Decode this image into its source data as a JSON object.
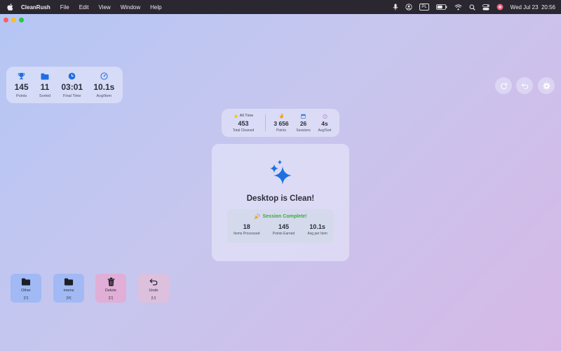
{
  "menubar": {
    "app_name": "CleanRush",
    "menus": [
      "File",
      "Edit",
      "View",
      "Window",
      "Help"
    ],
    "input_source": "PL",
    "datetime": "Wed Jul 23  20:56"
  },
  "session_stats": [
    {
      "icon": "trophy-icon",
      "value": "145",
      "label": "Points"
    },
    {
      "icon": "folder-icon",
      "value": "11",
      "label": "Sorted"
    },
    {
      "icon": "clock-icon",
      "value": "03:01",
      "label": "Final Time"
    },
    {
      "icon": "speedometer-icon",
      "value": "10.1s",
      "label": "Avg/Item"
    }
  ],
  "all_time": {
    "heading": "All Time",
    "total_value": "453",
    "total_label": "Total Cleaned",
    "stats": [
      {
        "icon": "flame-icon",
        "value": "3 656",
        "label": "Points"
      },
      {
        "icon": "calendar-icon",
        "value": "26",
        "label": "Sessions"
      },
      {
        "icon": "timer-icon",
        "value": "4s",
        "label": "Avg/Sort"
      }
    ]
  },
  "main": {
    "title": "Desktop is Clean!",
    "session_heading": "Session Complete!",
    "session_stats": [
      {
        "value": "18",
        "label": "Items Processed"
      },
      {
        "value": "145",
        "label": "Points Earned"
      },
      {
        "value": "10.1s",
        "label": "Avg per Item"
      }
    ]
  },
  "actions": [
    {
      "label": "Other",
      "key": "[O]"
    },
    {
      "label": "mems",
      "key": "[M]"
    },
    {
      "label": "Delete",
      "key": "[D]"
    },
    {
      "label": "Undo",
      "key": "[U]"
    }
  ],
  "colors": {
    "accent_blue": "#1f6fe0",
    "success_green": "#3fa843",
    "flame_orange": "#f5a623",
    "timer_purple": "#b36ad9"
  }
}
